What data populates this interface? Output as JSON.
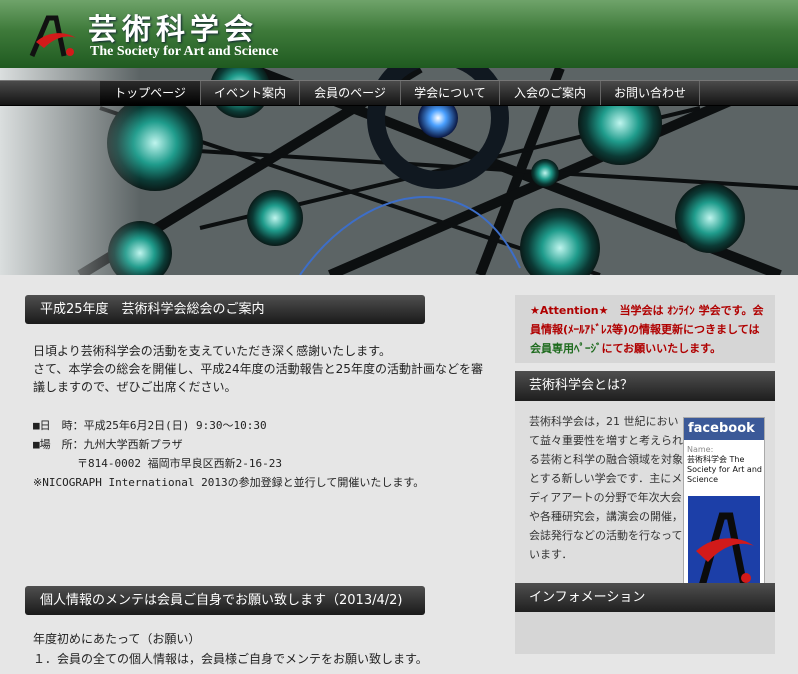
{
  "site": {
    "title_jp": "芸術科学会",
    "title_en": "The Society for Art and Science"
  },
  "nav": {
    "items": [
      {
        "label": "トップページ"
      },
      {
        "label": "イベント案内"
      },
      {
        "label": "会員のページ"
      },
      {
        "label": "学会について"
      },
      {
        "label": "入会のご案内"
      },
      {
        "label": "お問い合わせ"
      }
    ]
  },
  "main": {
    "section1": {
      "heading": "平成25年度　芸術科学会総会のご案内",
      "lines": [
        "日頃より芸術科学会の活動を支えていただき深く感謝いたします。",
        "さて、本学会の総会を開催し、平成24年度の活動報告と25年度の活動計画などを審",
        "議しますので、ぜひご出席ください。"
      ],
      "details": [
        "■日　時：平成25年6月2日(日) 9:30〜10:30",
        "■場　所：九州大学西新プラザ",
        "　　　　〒814-0002 福岡市早良区西新2-16-23",
        "※NICOGRAPH International 2013の参加登録と並行して開催いたします。"
      ]
    },
    "section2": {
      "heading": "個人情報のメンテは会員ご自身でお願い致します（2013/4/2)",
      "lines": [
        "年度初めにあたって（お願い）",
        "１．会員の全ての個人情報は，会員様ご自身でメンテをお願い致します。"
      ]
    }
  },
  "sidebar": {
    "attention": {
      "part1": "★Attention★　当学会は ｵﾝﾗｲﾝ 学会です。会員情報(ﾒｰﾙｱﾄﾞﾚｽ等)の情報更新につきましては",
      "link": "会員専用ﾍﾟｰｼﾞ",
      "part2": "にてお願いいたします。"
    },
    "about": {
      "heading": "芸術科学会とは？",
      "text": "芸術科学会は，21 世紀において益々重要性を増すと考えられる芸術と科学の融合領域を対象とする新しい学会です．主にメディアアートの分野で年次大会や各種研究会，講演会の開催，会誌発行などの活動を行なっています．"
    },
    "facebook": {
      "brand": "facebook",
      "name_label": "Name:",
      "name": "芸術科学会 The Society for Art and Science"
    },
    "info": {
      "heading": "インフォメーション"
    }
  },
  "colors": {
    "header_green": "#3e7a3a",
    "attention_red": "#b00000",
    "attention_green": "#1e6b1e",
    "facebook_blue": "#3b5998"
  }
}
